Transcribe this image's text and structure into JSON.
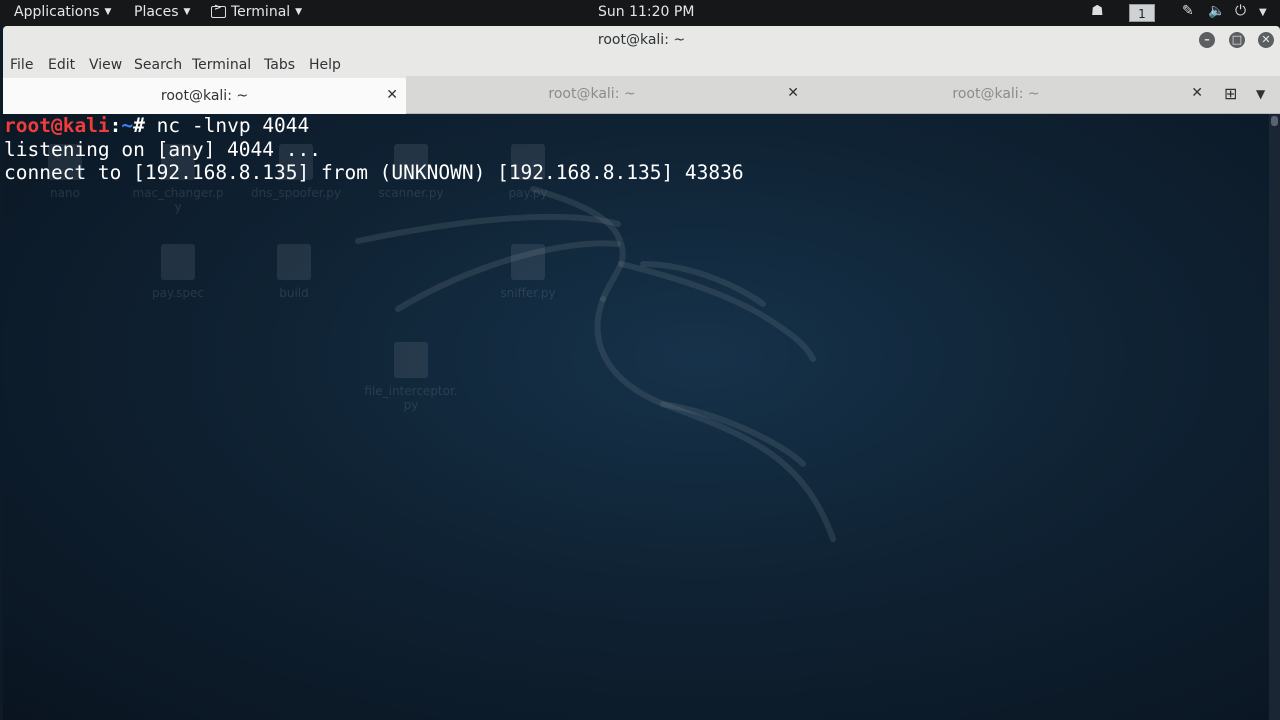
{
  "topbar": {
    "applications": "Applications",
    "places": "Places",
    "terminal": "Terminal",
    "clock": "Sun 11:20 PM",
    "workspace": "1"
  },
  "window": {
    "title": "root@kali: ~"
  },
  "menu": [
    "File",
    "Edit",
    "View",
    "Search",
    "Terminal",
    "Tabs",
    "Help"
  ],
  "tabs": [
    {
      "label": "root@kali: ~",
      "active": true
    },
    {
      "label": "root@kali: ~",
      "active": false
    },
    {
      "label": "root@kali: ~",
      "active": false
    }
  ],
  "terminal": {
    "prompt_user": "root@kali",
    "prompt_sep": ":",
    "prompt_path": "~",
    "prompt_char": "# ",
    "command": "nc -lnvp 4044",
    "output": [
      "listening on [any] 4044 ...",
      "connect to [192.168.8.135] from (UNKNOWN) [192.168.8.135] 43836"
    ]
  },
  "desktop_icons": [
    {
      "label": "nano"
    },
    {
      "label": "mac_changer.p\ny"
    },
    {
      "label": "dns_spoofer.py"
    },
    {
      "label": "scanner.py"
    },
    {
      "label": "pay.py"
    },
    {
      "label": "pay.spec"
    },
    {
      "label": "build"
    },
    {
      "label": "sniffer.py"
    },
    {
      "label": "file_interceptor.\npy"
    }
  ],
  "icons": {
    "terminal_app": "terminal-icon",
    "close": "close-icon",
    "minimize": "minimize-icon",
    "maximize": "maximize-icon",
    "new_tab": "new-tab-icon",
    "tab_menu": "chevron-down-icon",
    "power": "power-icon",
    "volume": "volume-icon",
    "network": "network-icon"
  }
}
